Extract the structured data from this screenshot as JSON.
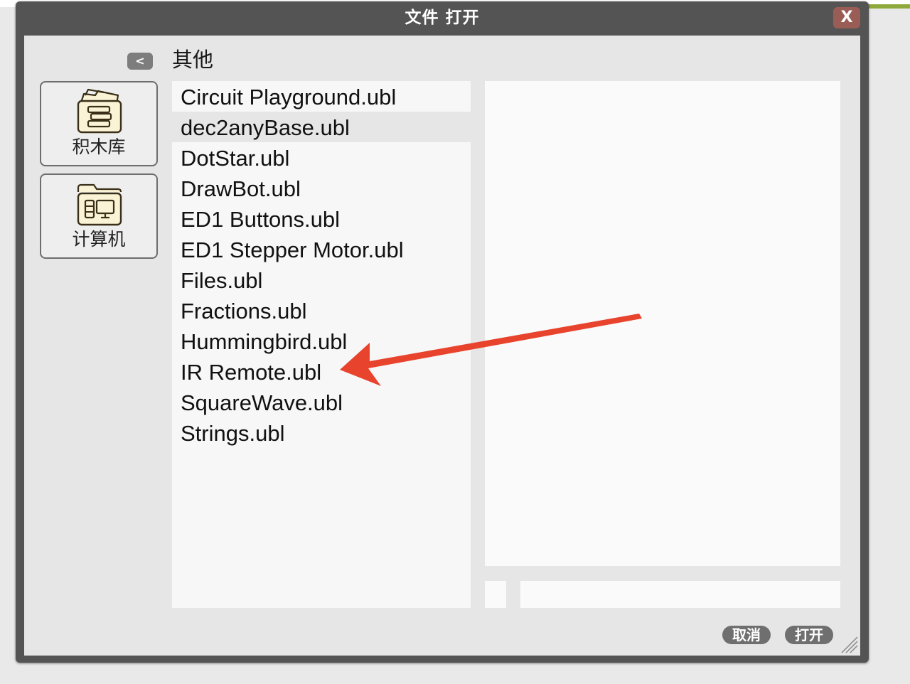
{
  "dialog": {
    "title": "文件 打开",
    "close_label": "X",
    "back_label": "<",
    "current_folder": "其他"
  },
  "sidebar": {
    "items": [
      {
        "label": "积木库",
        "icon": "library-books-icon"
      },
      {
        "label": "计算机",
        "icon": "computer-folder-icon"
      }
    ]
  },
  "files": [
    "Circuit Playground.ubl",
    "dec2anyBase.ubl",
    "DotStar.ubl",
    "DrawBot.ubl",
    "ED1 Buttons.ubl",
    "ED1 Stepper Motor.ubl",
    "Files.ubl",
    "Fractions.ubl",
    "Hummingbird.ubl",
    "IR Remote.ubl",
    "SquareWave.ubl",
    "Strings.ubl"
  ],
  "selected_file": "dec2anyBase.ubl",
  "annotation": {
    "type": "red-arrow",
    "points_to": "IR Remote.ubl",
    "color": "#e8432c"
  },
  "buttons": {
    "cancel": "取消",
    "open": "打开"
  },
  "colors": {
    "title_bar": "#545454",
    "close_button": "#9a5d55",
    "button": "#6f6f6f",
    "background_accent": "#8faa3c"
  }
}
